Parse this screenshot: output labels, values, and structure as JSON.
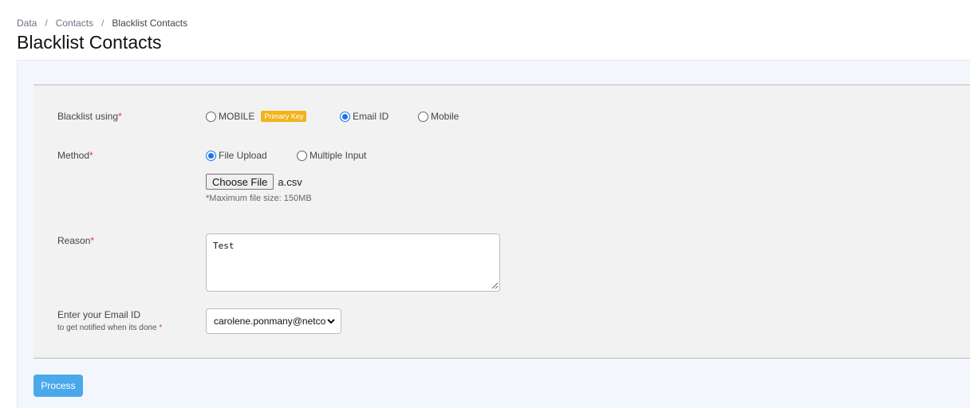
{
  "breadcrumb": [
    "Data",
    "Contacts",
    "Blacklist Contacts"
  ],
  "breadcrumb_separator": "/",
  "page_title": "Blacklist Contacts",
  "form": {
    "blacklist_using": {
      "label": "Blacklist using",
      "required_mark": "*",
      "options": [
        {
          "label": "MOBILE",
          "badge": "Primary Key",
          "checked": false
        },
        {
          "label": "Email ID",
          "checked": true
        },
        {
          "label": "Mobile",
          "checked": false
        }
      ]
    },
    "method": {
      "label": "Method",
      "required_mark": "*",
      "options": [
        {
          "label": "File Upload",
          "checked": true
        },
        {
          "label": "Multiple Input",
          "checked": false
        }
      ],
      "file_button": "Choose File",
      "file_name": "a.csv",
      "hint": "*Maximum file size: 150MB"
    },
    "reason": {
      "label": "Reason",
      "required_mark": "*",
      "value": "Test"
    },
    "email": {
      "label": "Enter your Email ID",
      "sublabel": "to get notified when its done",
      "required_mark": "*",
      "selected": "carolene.ponmany@netco"
    }
  },
  "process_button": "Process",
  "colors": {
    "accent": "#1a73e8",
    "badge": "#f2b31b",
    "process_button": "#4aa9ea",
    "required": "#e53935"
  }
}
